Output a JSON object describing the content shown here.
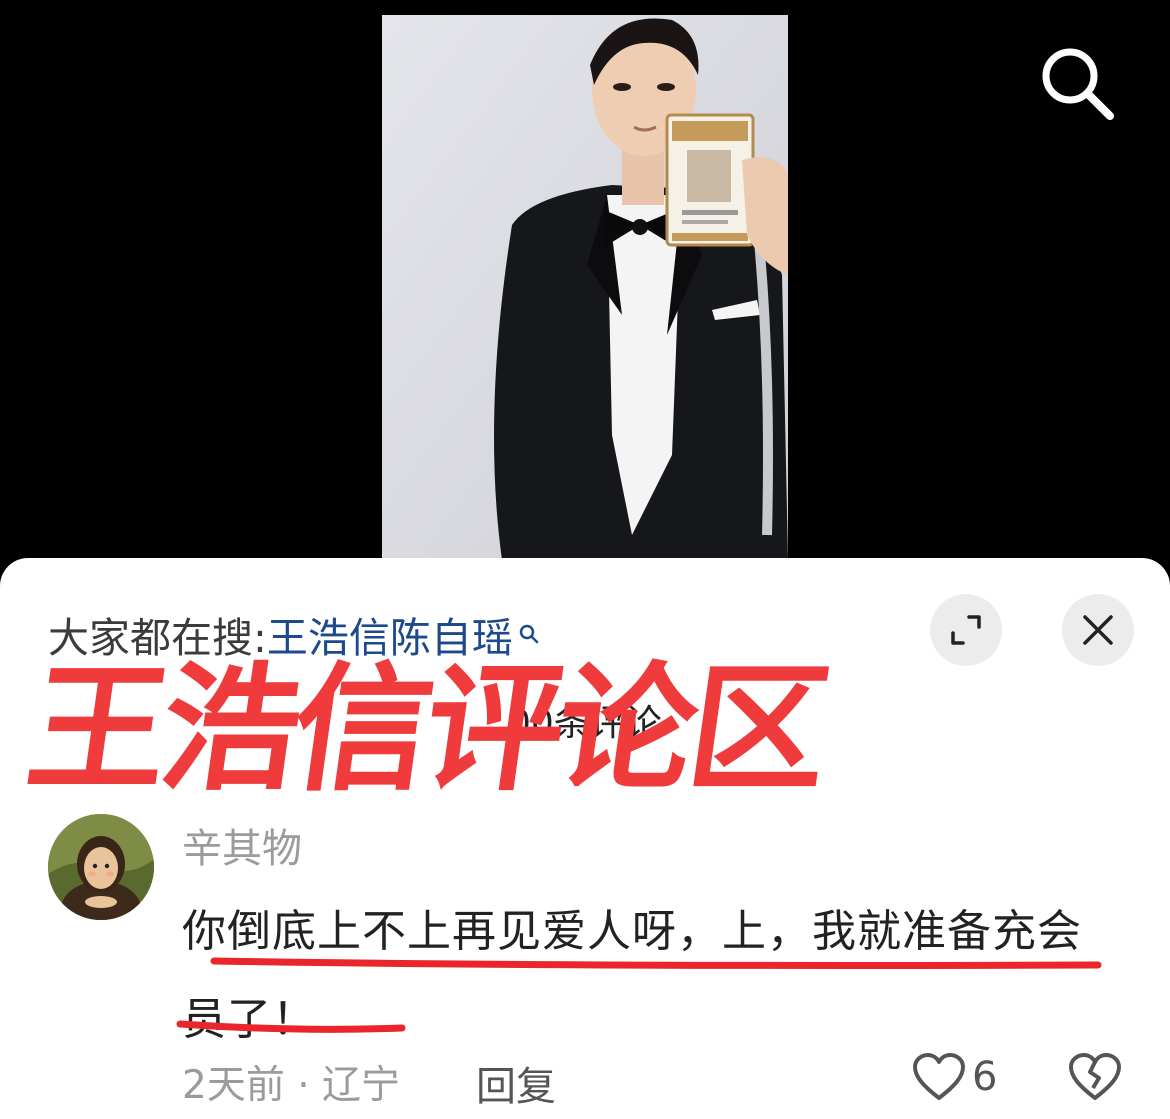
{
  "header": {
    "search_icon": "search-icon"
  },
  "sheet": {
    "trending_prefix": "大家都在搜:",
    "trending_keyword": "王浩信陈自瑶",
    "comment_count_text": "00条评论",
    "overlay_title": "王浩信评论区",
    "expand_icon": "expand-icon",
    "close_icon": "close-icon"
  },
  "comment": {
    "username": "辛其物",
    "text": "你倒底上不上再见爱人呀，上，我就准备充会员了！",
    "time": "2天前",
    "separator": "·",
    "location": "辽宁",
    "reply_label": "回复",
    "like_count": "6"
  },
  "colors": {
    "accent_red": "#ef3b3b",
    "link_blue": "#1d4a8c",
    "underline_red": "#e8262b"
  }
}
